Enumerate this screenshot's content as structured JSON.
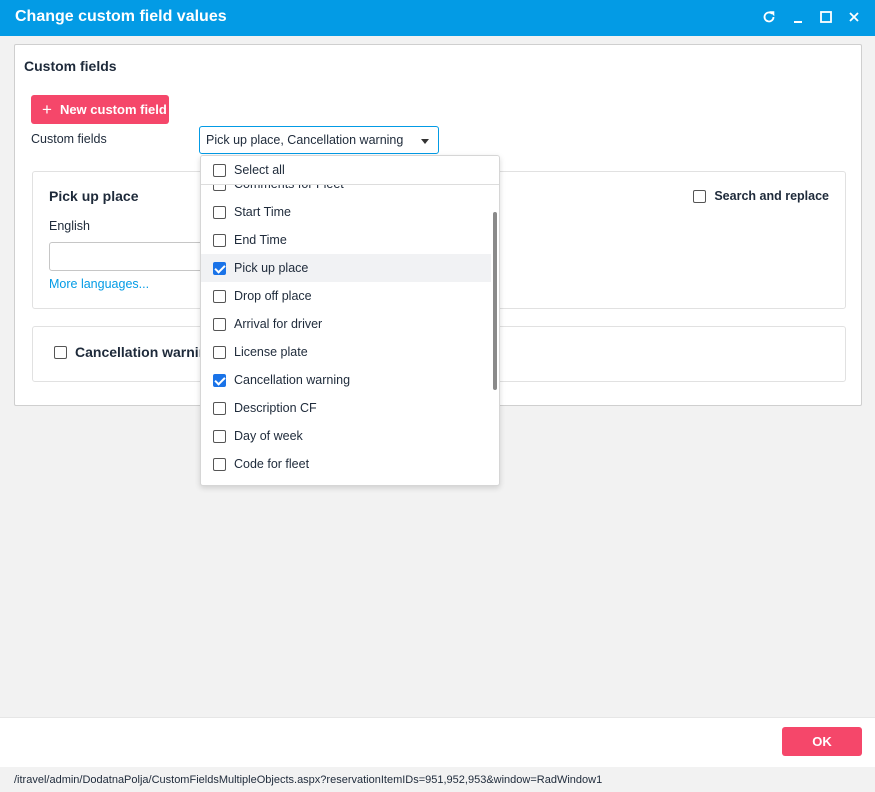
{
  "window": {
    "title": "Change custom field values"
  },
  "panel": {
    "title": "Custom fields",
    "new_button": "New custom field",
    "fields_label": "Custom fields",
    "select_value": "Pick up place, Cancellation warning"
  },
  "card1": {
    "heading": "Pick up place",
    "language_label": "English",
    "input_value": "",
    "more_languages": "More languages...",
    "search_replace": "Search and replace"
  },
  "card2": {
    "label": "Cancellation warning"
  },
  "dropdown": {
    "select_all": "Select all",
    "items": [
      {
        "label": "Comments for Fleet",
        "checked": false
      },
      {
        "label": "Start Time",
        "checked": false
      },
      {
        "label": "End Time",
        "checked": false
      },
      {
        "label": "Pick up place",
        "checked": true
      },
      {
        "label": "Drop off place",
        "checked": false
      },
      {
        "label": "Arrival for driver",
        "checked": false
      },
      {
        "label": "License plate",
        "checked": false
      },
      {
        "label": "Cancellation warning",
        "checked": true
      },
      {
        "label": "Description CF",
        "checked": false
      },
      {
        "label": "Day of week",
        "checked": false
      },
      {
        "label": "Code for fleet",
        "checked": false
      },
      {
        "label": "",
        "checked": false
      }
    ]
  },
  "footer": {
    "ok_label": "OK"
  },
  "status": {
    "url": "/itravel/admin/DodatnaPolja/CustomFieldsMultipleObjects.aspx?reservationItemIDs=951,952,953&window=RadWindow1"
  },
  "colors": {
    "titlebar": "#039be5",
    "accent": "#f5476a",
    "link": "#039be5",
    "checked": "#1a73e8"
  }
}
